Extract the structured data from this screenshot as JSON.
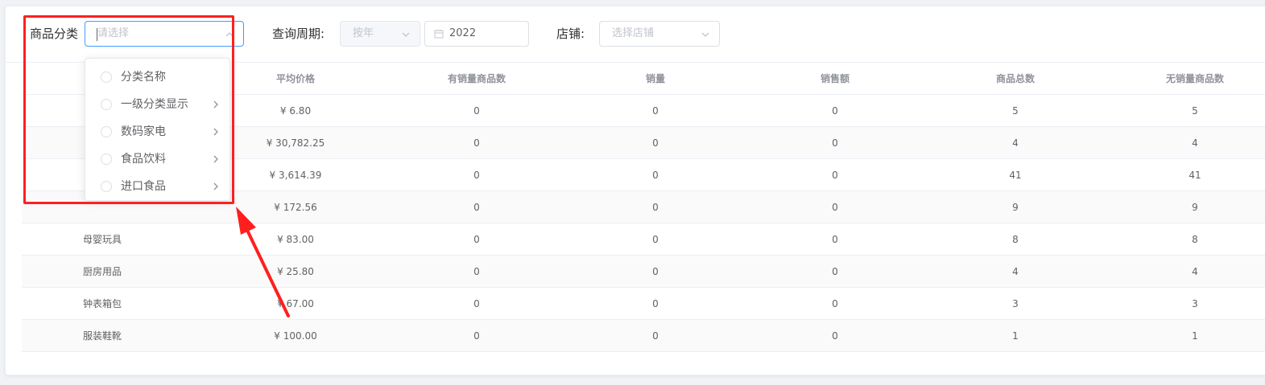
{
  "filters": {
    "category_label": "商品分类",
    "category_placeholder": "请选择",
    "period_label": "查询周期:",
    "period_type": "按年",
    "period_year": "2022",
    "store_label": "店铺:",
    "store_placeholder": "选择店铺"
  },
  "dropdown": {
    "items": [
      {
        "label": "分类名称",
        "has_children": false
      },
      {
        "label": "一级分类显示",
        "has_children": true
      },
      {
        "label": "数码家电",
        "has_children": true
      },
      {
        "label": "食品饮料",
        "has_children": true
      },
      {
        "label": "进口食品",
        "has_children": true
      }
    ]
  },
  "table": {
    "columns": [
      "平均价格",
      "有销量商品数",
      "销量",
      "销售额",
      "商品总数",
      "无销量商品数"
    ],
    "rows": [
      {
        "name": "",
        "avg_price": "¥ 6.80",
        "sold_items": "0",
        "sales": "0",
        "revenue": "0",
        "total": "5",
        "unsold": "5"
      },
      {
        "name": "",
        "avg_price": "¥ 30,782.25",
        "sold_items": "0",
        "sales": "0",
        "revenue": "0",
        "total": "4",
        "unsold": "4"
      },
      {
        "name": "",
        "avg_price": "¥ 3,614.39",
        "sold_items": "0",
        "sales": "0",
        "revenue": "0",
        "total": "41",
        "unsold": "41"
      },
      {
        "name": "",
        "avg_price": "¥ 172.56",
        "sold_items": "0",
        "sales": "0",
        "revenue": "0",
        "total": "9",
        "unsold": "9"
      },
      {
        "name": "母婴玩具",
        "avg_price": "¥ 83.00",
        "sold_items": "0",
        "sales": "0",
        "revenue": "0",
        "total": "8",
        "unsold": "8"
      },
      {
        "name": "厨房用品",
        "avg_price": "¥ 25.80",
        "sold_items": "0",
        "sales": "0",
        "revenue": "0",
        "total": "4",
        "unsold": "4"
      },
      {
        "name": "钟表箱包",
        "avg_price": "¥ 67.00",
        "sold_items": "0",
        "sales": "0",
        "revenue": "0",
        "total": "3",
        "unsold": "3"
      },
      {
        "name": "服装鞋靴",
        "avg_price": "¥ 100.00",
        "sold_items": "0",
        "sales": "0",
        "revenue": "0",
        "total": "1",
        "unsold": "1"
      }
    ]
  },
  "colors": {
    "accent": "#409eff",
    "highlight": "#ff1f1f"
  }
}
